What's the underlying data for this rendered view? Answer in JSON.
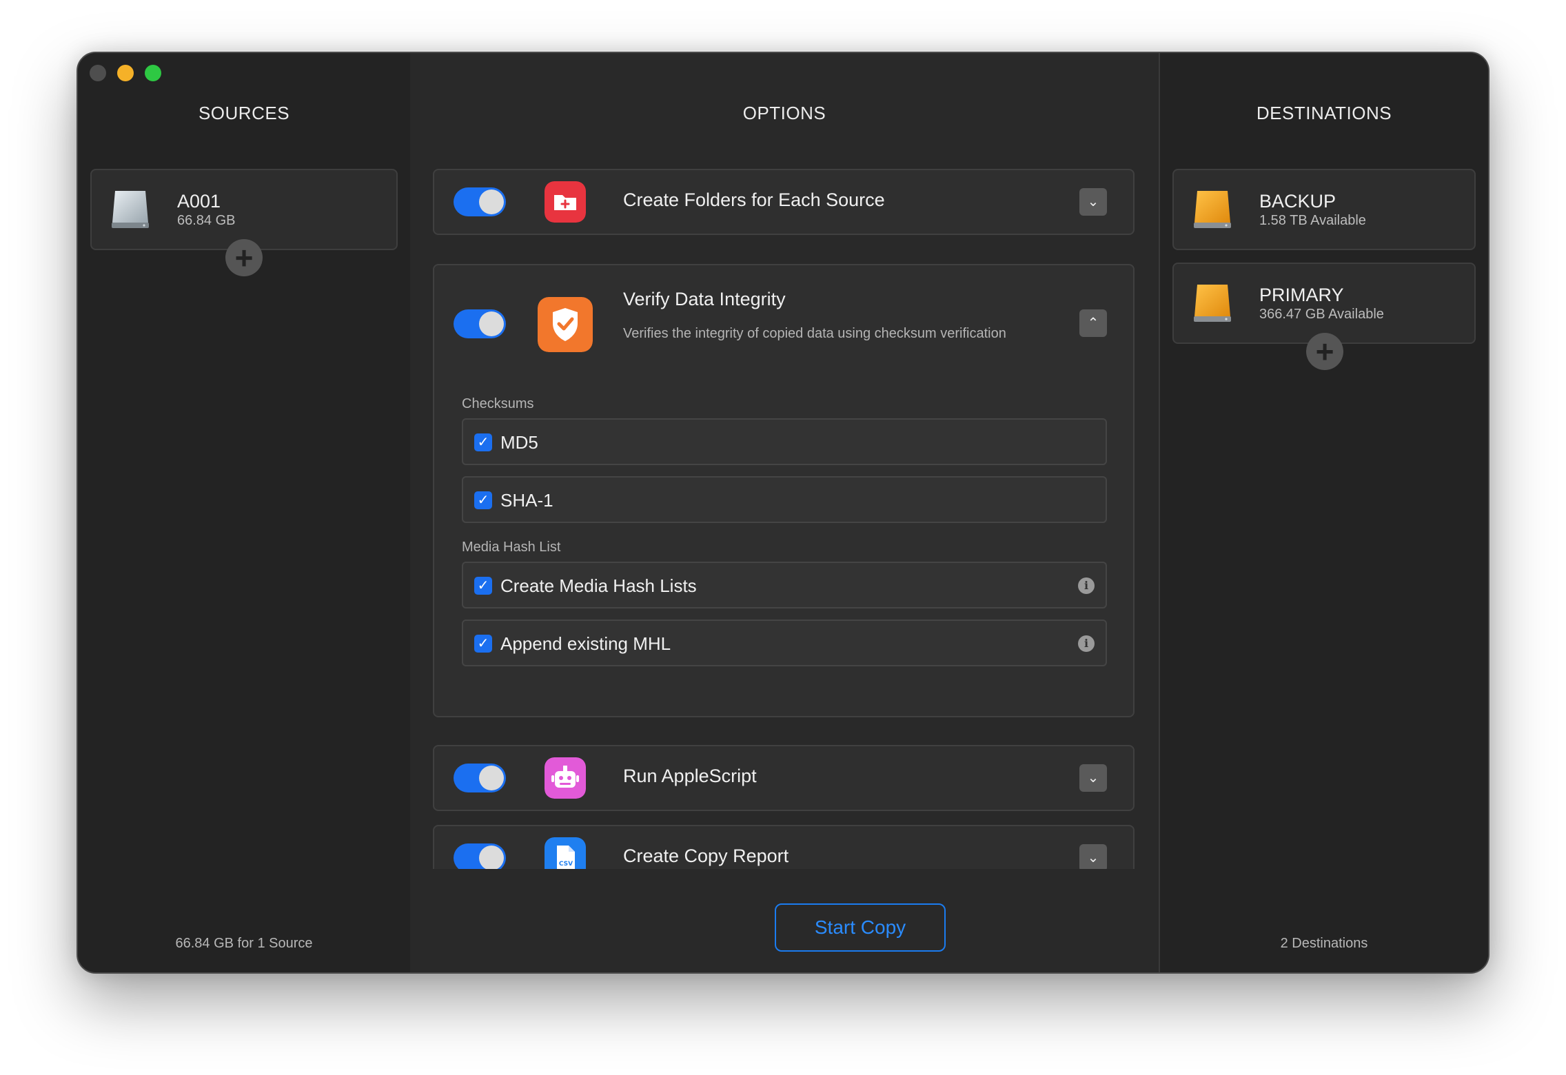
{
  "window": {
    "traffic_colors": [
      "#4e4e4e",
      "#f5b128",
      "#2ec843"
    ]
  },
  "sources": {
    "title": "SOURCES",
    "items": [
      {
        "name": "A001",
        "size": "66.84 GB",
        "icon": "internal-disk-icon"
      }
    ],
    "footer": "66.84 GB for 1 Source"
  },
  "options": {
    "title": "OPTIONS",
    "items": [
      {
        "title": "Create Folders for Each Source",
        "enabled": true,
        "icon": "folder-plus-icon",
        "icon_color": "#e8343f",
        "expanded": false
      },
      {
        "title": "Verify Data Integrity",
        "enabled": true,
        "icon": "shield-check-icon",
        "icon_color": "#f2772c",
        "expanded": true,
        "description": "Verifies the integrity of copied data using checksum verification",
        "checksums_label": "Checksums",
        "checksums": [
          {
            "label": "MD5",
            "checked": true
          },
          {
            "label": "SHA-1",
            "checked": true
          }
        ],
        "mhl_label": "Media Hash List",
        "mhl": [
          {
            "label": "Create Media Hash Lists",
            "checked": true
          },
          {
            "label": "Append existing MHL",
            "checked": true
          }
        ]
      },
      {
        "title": "Run AppleScript",
        "enabled": true,
        "icon": "robot-icon",
        "icon_color": "#e25ad8",
        "expanded": false
      },
      {
        "title": "Create Copy Report",
        "enabled": true,
        "icon": "csv-document-icon",
        "icon_color": "#1f7ff0",
        "expanded": false
      }
    ],
    "start_button": "Start Copy"
  },
  "destinations": {
    "title": "DESTINATIONS",
    "items": [
      {
        "name": "BACKUP",
        "available": "1.58 TB Available",
        "icon": "external-disk-icon"
      },
      {
        "name": "PRIMARY",
        "available": "366.47 GB Available",
        "icon": "external-disk-icon"
      }
    ],
    "footer": "2 Destinations"
  },
  "accent_color": "#1b6ff0"
}
